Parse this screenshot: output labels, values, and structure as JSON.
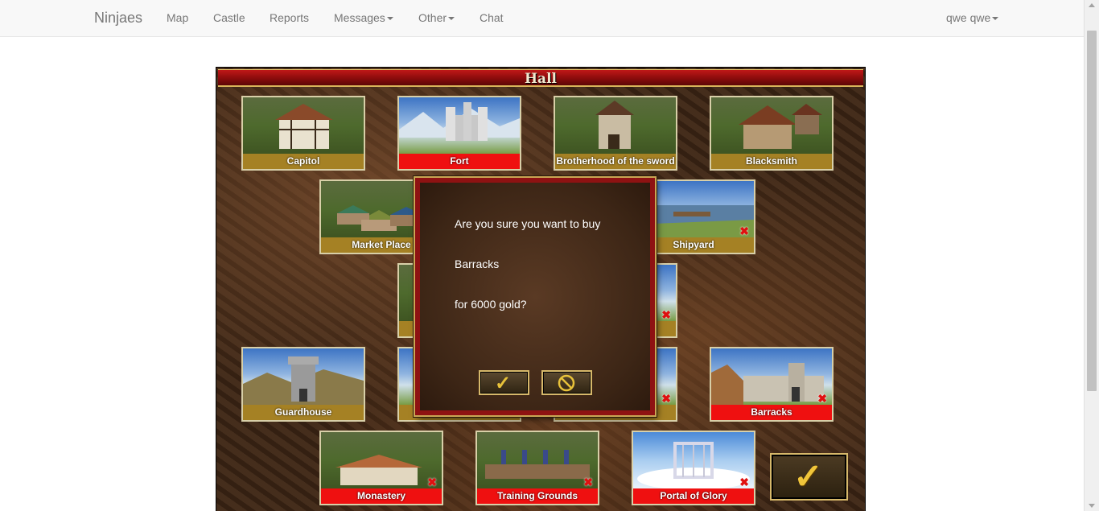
{
  "navbar": {
    "brand": "Ninjaes",
    "links": [
      "Map",
      "Castle",
      "Reports"
    ],
    "messages": "Messages",
    "other": "Other",
    "chat": "Chat",
    "user": "qwe qwe"
  },
  "hall": {
    "title": "Hall",
    "buildings": [
      {
        "name": "Capitol",
        "status": "built"
      },
      {
        "name": "Fort",
        "status": "available"
      },
      {
        "name": "Brotherhood of the sword",
        "status": "built"
      },
      {
        "name": "Blacksmith",
        "status": "built"
      },
      {
        "name": "Market Place",
        "status": "built"
      },
      {
        "name": "Shipyard",
        "status": "unavailable"
      },
      {
        "name": "Guardhouse",
        "status": "built"
      },
      {
        "name": "Barracks",
        "status": "available"
      },
      {
        "name": "Monastery",
        "status": "unavailable"
      },
      {
        "name": "Training Grounds",
        "status": "unavailable"
      },
      {
        "name": "Portal of Glory",
        "status": "unavailable"
      }
    ]
  },
  "dialog": {
    "line1": "Are you sure you want to buy",
    "building": "Barracks",
    "cost": "for 6000 gold?",
    "confirm_icon": "checkmark-icon",
    "cancel_icon": "cancel-icon"
  },
  "colors": {
    "built_label": "#a58124",
    "available_label": "#ef1010",
    "unavailable_mark": "#e01010"
  }
}
